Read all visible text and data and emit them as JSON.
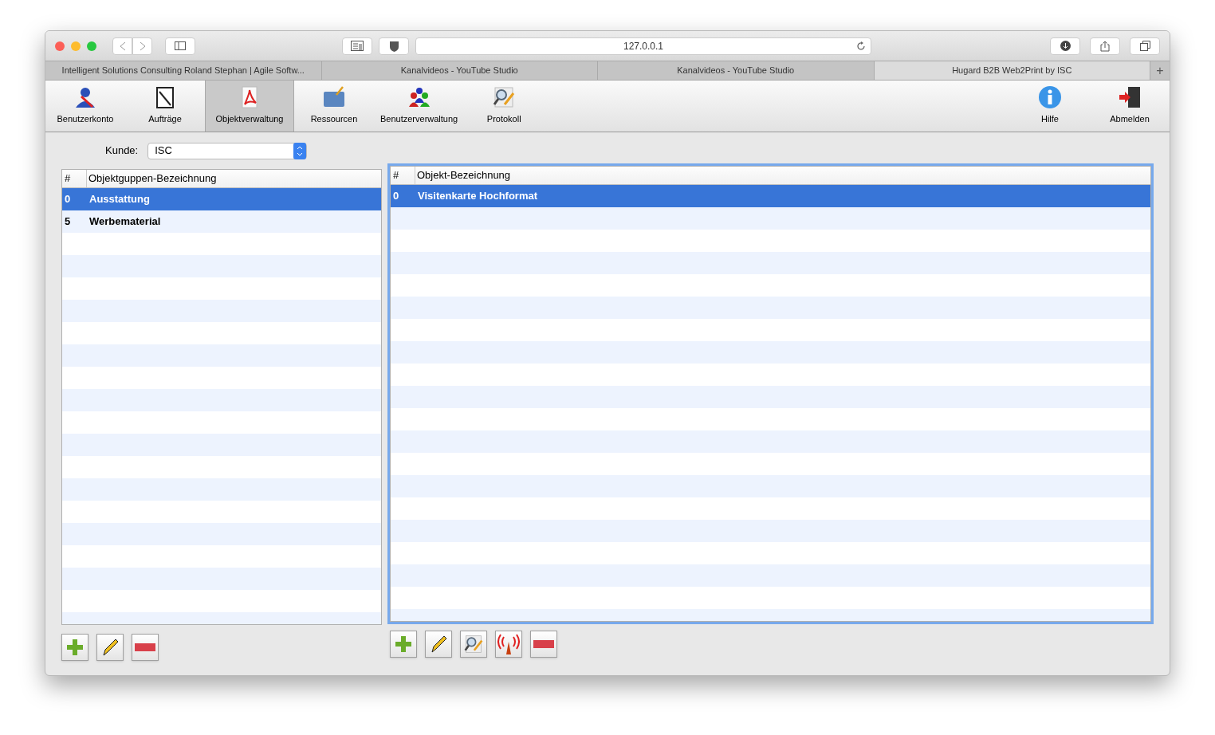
{
  "browser": {
    "address": "127.0.0.1"
  },
  "tabs": [
    {
      "label": "Intelligent Solutions Consulting Roland Stephan | Agile Softw...",
      "selected": false
    },
    {
      "label": "Kanalvideos - YouTube Studio",
      "selected": false
    },
    {
      "label": "Kanalvideos - YouTube Studio",
      "selected": false
    },
    {
      "label": "Hugard B2B Web2Print by ISC",
      "selected": true
    }
  ],
  "new_tab": "+",
  "toolbar": [
    {
      "label": "Benutzerkonto",
      "kind": "user",
      "selected": false
    },
    {
      "label": "Aufträge",
      "kind": "clipboard",
      "selected": false
    },
    {
      "label": "Objektverwaltung",
      "kind": "document",
      "selected": true
    },
    {
      "label": "Ressourcen",
      "kind": "folder",
      "selected": false
    },
    {
      "label": "Benutzerverwaltung",
      "kind": "users",
      "selected": false
    },
    {
      "label": "Protokoll",
      "kind": "inspect",
      "selected": false
    }
  ],
  "toolbar_right": [
    {
      "label": "Hilfe",
      "kind": "info",
      "selected": false
    },
    {
      "label": "Abmelden",
      "kind": "exit",
      "selected": false
    }
  ],
  "customer": {
    "label": "Kunde:",
    "value": "ISC"
  },
  "group_table": {
    "columns": [
      "#",
      "Objektguppen-Bezeichnung"
    ],
    "focused": false,
    "rows": [
      {
        "cells": [
          "0",
          "Ausstattung"
        ],
        "selected": true
      },
      {
        "cells": [
          "5",
          "Werbematerial"
        ],
        "selected": false
      }
    ],
    "buttons": [
      {
        "kind": "add"
      },
      {
        "kind": "edit"
      },
      {
        "kind": "remove"
      }
    ]
  },
  "object_table": {
    "columns": [
      "#",
      "Objekt-Bezeichnung"
    ],
    "focused": true,
    "rows": [
      {
        "cells": [
          "0",
          "Visitenkarte Hochformat"
        ],
        "selected": true
      }
    ],
    "buttons": [
      {
        "kind": "add"
      },
      {
        "kind": "edit"
      },
      {
        "kind": "inspect"
      },
      {
        "kind": "broadcast"
      },
      {
        "kind": "remove"
      }
    ]
  }
}
